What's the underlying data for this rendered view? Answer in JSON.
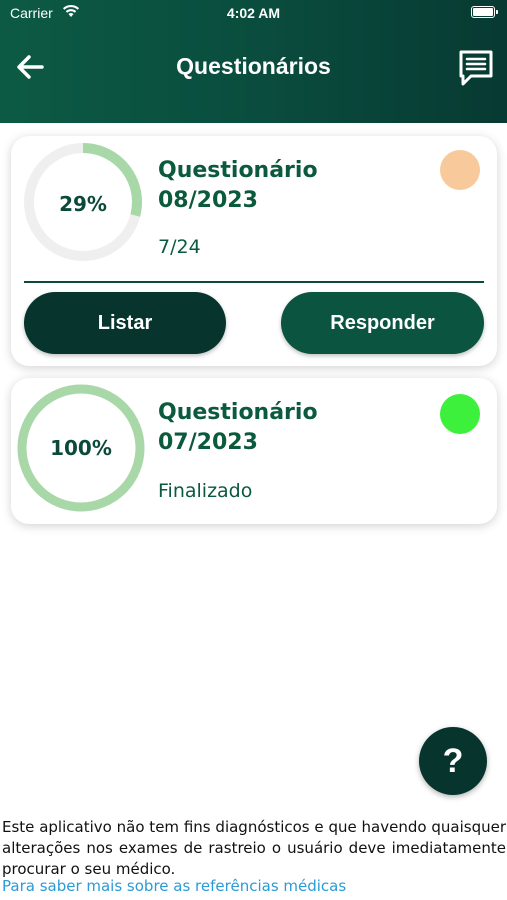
{
  "status_bar": {
    "carrier": "Carrier",
    "time": "4:02 AM"
  },
  "header": {
    "title": "Questionários",
    "back_icon": "arrow-left-icon",
    "chat_icon": "message-icon"
  },
  "questionnaires": [
    {
      "title_line1": "Questionário",
      "title_line2": "08/2023",
      "percent_label": "29%",
      "progress": 0.29,
      "subtitle": "7/24",
      "status_color": "#f8c99a",
      "buttons": {
        "list": "Listar",
        "answer": "Responder"
      }
    },
    {
      "title_line1": "Questionário",
      "title_line2": "07/2023",
      "percent_label": "100%",
      "progress": 1.0,
      "subtitle": "Finalizado",
      "status_color": "#3cf03c"
    }
  ],
  "help_button": {
    "label": "?"
  },
  "footer": {
    "disclaimer": "Este aplicativo não tem fins diagnósticos e que havendo quaisquer alterações nos exames de rastreio o usuário deve imediatamente procurar o seu médico.",
    "link": "Para saber mais sobre as referências médicas"
  },
  "colors": {
    "header_start": "#0c5a44",
    "header_end": "#073a32",
    "ring_progress": "#a8d8a8",
    "ring_track": "#efefef",
    "link": "#2b9bd6"
  }
}
